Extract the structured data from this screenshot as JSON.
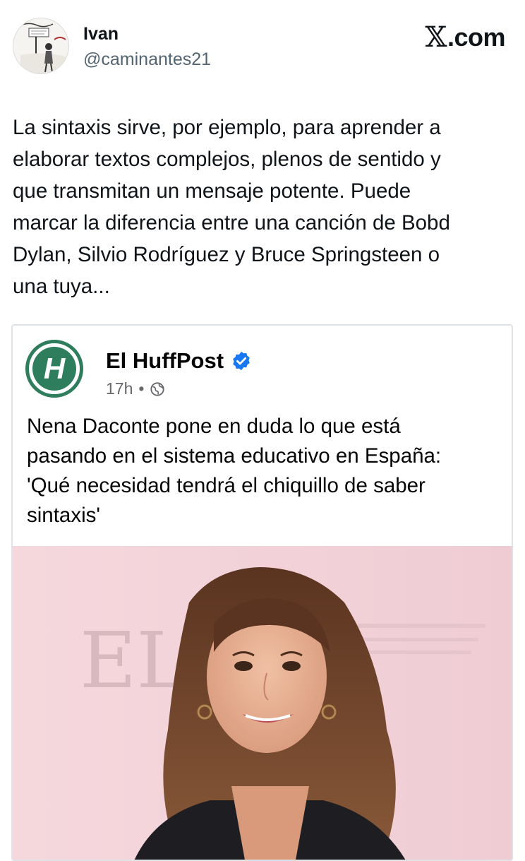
{
  "author": {
    "name": "Ivan",
    "handle": "@caminantes21"
  },
  "site": {
    "logo_mark": "𝕏",
    "logo_text": ".com"
  },
  "tweet": {
    "lines": [
      "La sintaxis sirve, por ejemplo, para aprender a",
      "elaborar textos complejos, plenos de sentido y",
      "que transmitan un mensaje potente. Puede",
      "marcar la diferencia entre una canción de Bobd",
      "Dylan, Silvio Rodríguez y Bruce Springsteen o",
      "una tuya..."
    ]
  },
  "quoted_post": {
    "page_name": "El HuffPost",
    "logo_letter": "H",
    "time": "17h",
    "separator": "•",
    "lines": [
      "Nena Daconte pone en duda lo que está",
      "pasando en el sistema educativo en España:",
      "'Qué necesidad tendrá el chiquillo de saber",
      "sintaxis'"
    ],
    "photo_backdrop_text": "EL"
  },
  "colors": {
    "huffpost_green": "#2e7d5c",
    "verified_blue": "#1877f2",
    "handle_gray": "#536471"
  },
  "icons": {
    "verified": "verified-badge-icon",
    "globe": "globe-icon"
  }
}
